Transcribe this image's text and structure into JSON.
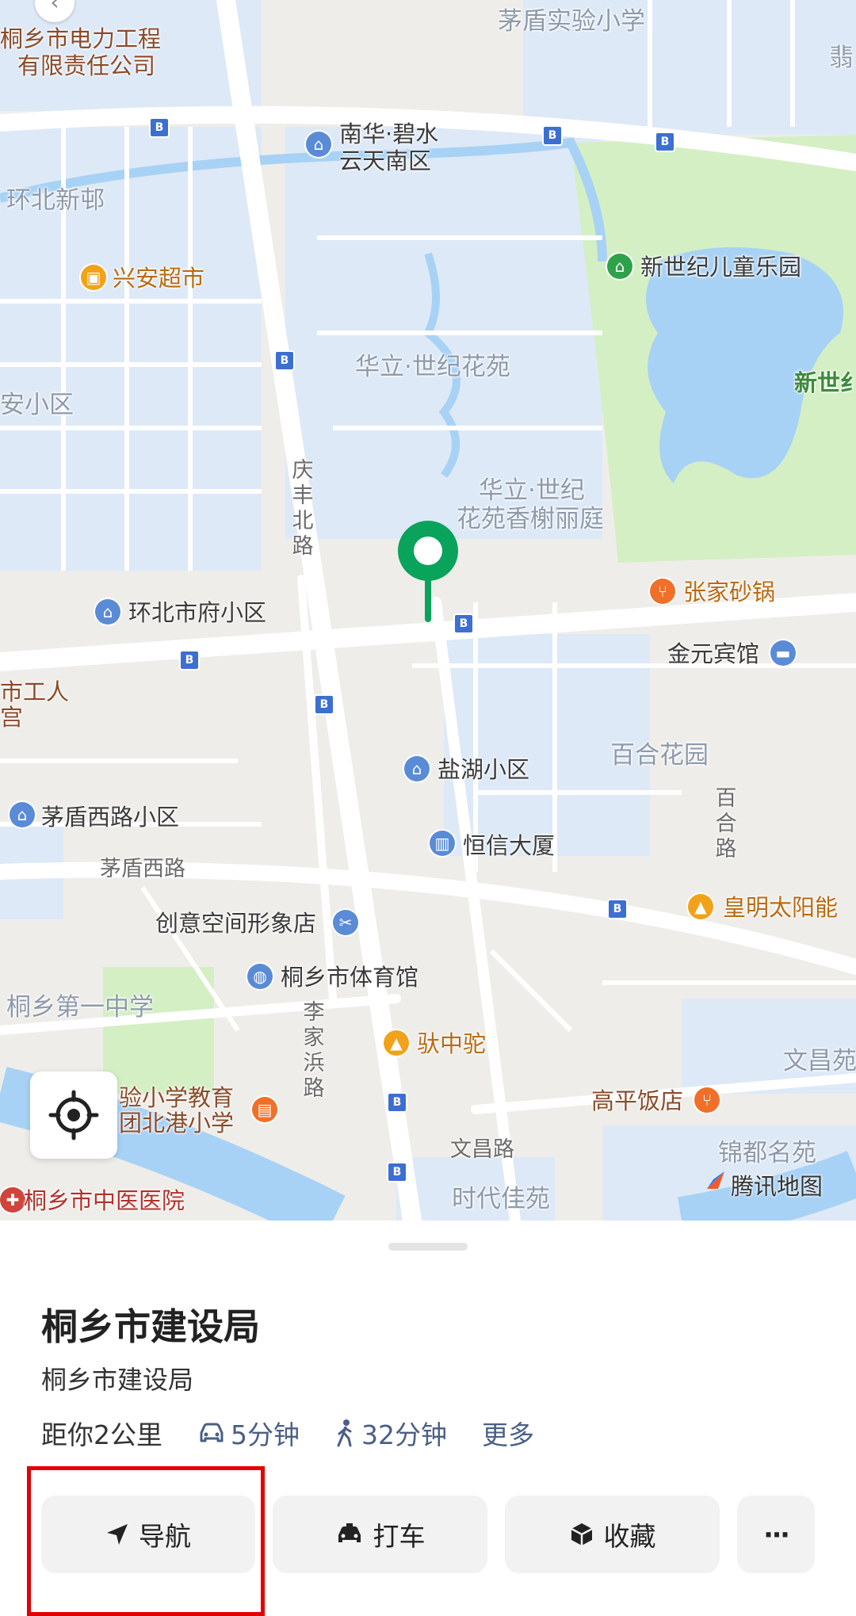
{
  "map": {
    "labels": {
      "maodun_school": "茅盾实验小学",
      "power_co_1": "桐乡市电力工程",
      "power_co_2": "有限责任公司",
      "nanhua_1": "南华·碧水",
      "nanhua_2": "云天南区",
      "huanbei": "环北新邨",
      "xingan": "兴安超市",
      "xinshiji_park": "新世纪儿童乐园",
      "xinshi_edge": "新世纟",
      "an_xiaoqu": "安小区",
      "huali_1": "华立·世纪花苑",
      "huali_2a": "华立·世纪",
      "huali_2b": "花苑香榭丽庭",
      "qingfeng_road": "庆丰北路",
      "zhangjia": "张家砂锅",
      "huanbei_fu": "环北市府小区",
      "jinyuan": "金元宾馆",
      "gongren_1": "市工人",
      "gongren_2": "宫",
      "yanhu": "盐湖小区",
      "baihe": "百合花园",
      "baihe_road": "百合路",
      "maodun_west_xq": "茅盾西路小区",
      "hengxin": "恒信大厦",
      "maodun_west_rd": "茅盾西路",
      "chuangyi": "创意空间形象店",
      "huangming": "皇明太阳能",
      "tiyuguan": "桐乡市体育馆",
      "diyi_zhongxue": "桐乡第一中学",
      "lijia_road": "李家浜路",
      "tuozhongtuo": "驮中驼",
      "wenchang_edge": "文昌苑",
      "shiyan_1": "验小学教育",
      "shiyan_2": "团北港小学",
      "gaoping": "高平饭店",
      "wenchang_road": "文昌路",
      "jindu": "锦都名苑",
      "zhongyiyuan": "桐乡市中医医院",
      "shidai": "时代佳苑",
      "brand": "腾讯地图",
      "weng_edge": "翡"
    },
    "bus_glyph": "B",
    "icons": {
      "location_button": "locate-icon",
      "marker": "place-marker-icon"
    }
  },
  "place": {
    "title": "桐乡市建设局",
    "subtitle": "桐乡市建设局",
    "distance": "距你2公里",
    "drive_time": "5分钟",
    "walk_time": "32分钟",
    "more": "更多"
  },
  "actions": {
    "navigate": "导航",
    "taxi": "打车",
    "favorite": "收藏",
    "more": "···"
  },
  "colors": {
    "marker_green": "#0aa35c",
    "accent_blue": "#4b5f86",
    "highlight_red": "#e30000",
    "water": "#a8d2f5",
    "park": "#d4efc4"
  }
}
